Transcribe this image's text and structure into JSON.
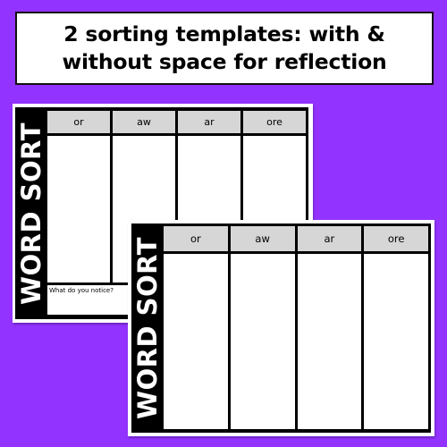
{
  "background_color": "#9233ff",
  "banner": {
    "line1": "2 sorting templates: with &",
    "line2": "without space for reflection"
  },
  "templates": [
    {
      "name": "with-reflection",
      "side_title": "WORD SORT",
      "columns": [
        "or",
        "aw",
        "ar",
        "ore"
      ],
      "reflection_prompt": "What do you notice?",
      "header_color": "#d6d6d6"
    },
    {
      "name": "without-reflection",
      "side_title": "WORD SORT",
      "columns": [
        "or",
        "aw",
        "ar",
        "ore"
      ],
      "header_color": "#d6d6d6"
    }
  ]
}
